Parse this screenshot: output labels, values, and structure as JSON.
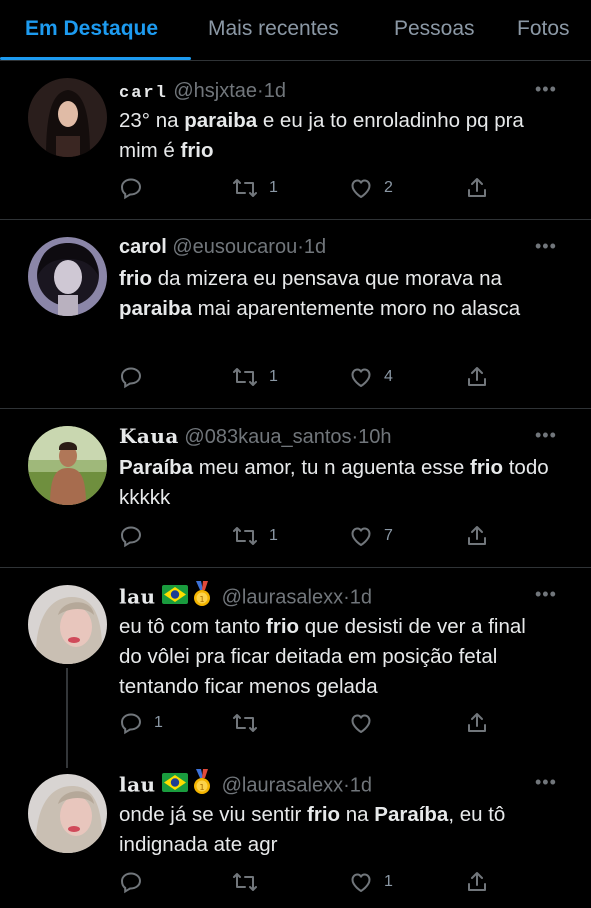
{
  "tabs": [
    {
      "label": "Em Destaque",
      "active": true
    },
    {
      "label": "Mais recentes",
      "active": false
    },
    {
      "label": "Pessoas",
      "active": false
    },
    {
      "label": "Fotos",
      "active": false
    }
  ],
  "tweets": [
    {
      "name": "carl",
      "handle": "@hsjxtae",
      "time": "1d",
      "body": [
        {
          "text": "23° na ",
          "bold": false
        },
        {
          "text": "paraiba",
          "bold": true
        },
        {
          "text": " e eu ja to enroladinho pq pra mim é ",
          "bold": false
        },
        {
          "text": "frio",
          "bold": true
        }
      ],
      "replies": "",
      "retweets": "1",
      "likes": "2"
    },
    {
      "name": "carol",
      "handle": "@eusoucarou",
      "time": "1d",
      "body": [
        {
          "text": "frio",
          "bold": true
        },
        {
          "text": " da mizera eu pensava que morava na ",
          "bold": false
        },
        {
          "text": "paraiba",
          "bold": true
        },
        {
          "text": " mai aparentemente moro no alasca",
          "bold": false
        }
      ],
      "replies": "",
      "retweets": "1",
      "likes": "4"
    },
    {
      "name": "Kaua",
      "handle": "@083kaua_santos",
      "time": "10h",
      "body": [
        {
          "text": "Paraíba",
          "bold": true
        },
        {
          "text": " meu amor, tu n aguenta esse ",
          "bold": false
        },
        {
          "text": "frio",
          "bold": true
        },
        {
          "text": " todo kkkkk",
          "bold": false
        }
      ],
      "replies": "",
      "retweets": "1",
      "likes": "7"
    },
    {
      "name": "lau",
      "emoji": "🇧🇷 🥇",
      "handle": "@laurasalexx",
      "time": "1d",
      "body": [
        {
          "text": "eu tô com tanto ",
          "bold": false
        },
        {
          "text": "frio",
          "bold": true
        },
        {
          "text": " que desisti de ver a final do vôlei pra ficar deitada em posição fetal tentando ficar menos gelada",
          "bold": false
        }
      ],
      "replies": "1",
      "retweets": "",
      "likes": ""
    },
    {
      "name": "lau",
      "emoji": "🇧🇷 🥇",
      "handle": "@laurasalexx",
      "time": "1d",
      "body": [
        {
          "text": "onde já se viu sentir ",
          "bold": false
        },
        {
          "text": "frio",
          "bold": true
        },
        {
          "text": " na ",
          "bold": false
        },
        {
          "text": "Paraíba",
          "bold": true
        },
        {
          "text": ", eu tô indignada ate agr",
          "bold": false
        }
      ],
      "replies": "",
      "retweets": "",
      "likes": "1"
    }
  ],
  "colors": {
    "background": "#000000",
    "accent": "#1d9bf0",
    "muted": "#71767b",
    "text": "#e7e9ea",
    "border": "#2f3336"
  },
  "icons": [
    "reply-icon",
    "retweet-icon",
    "like-icon",
    "share-icon",
    "more-icon",
    "brazil-flag-icon",
    "gold-medal-icon"
  ]
}
